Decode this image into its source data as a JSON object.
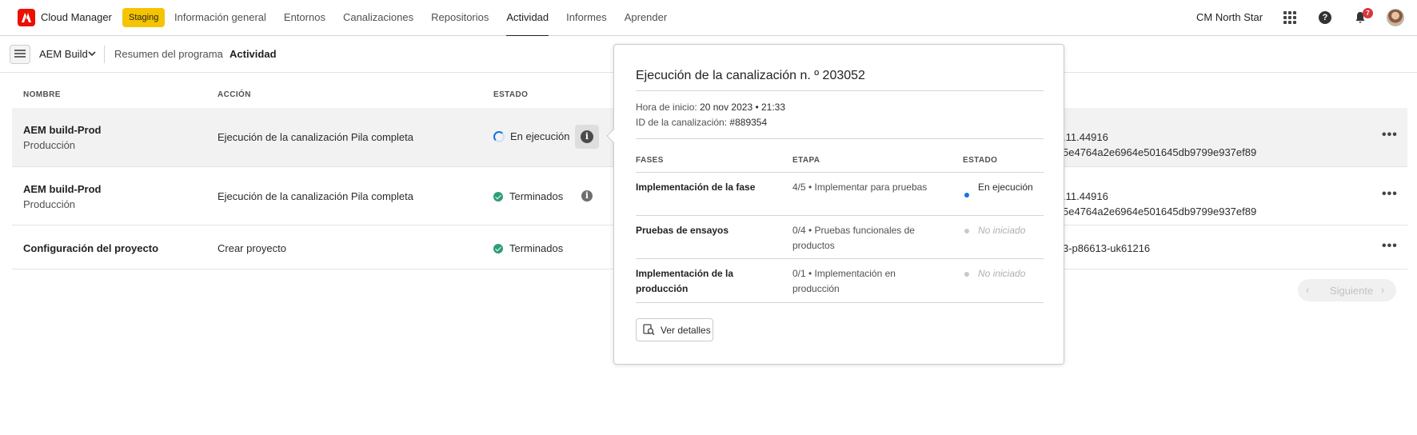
{
  "app": {
    "name": "Cloud Manager",
    "environment_badge": "Staging",
    "org_name": "CM North Star",
    "notification_count": "7"
  },
  "nav": {
    "items": [
      {
        "label": "Información general",
        "active": false
      },
      {
        "label": "Entornos",
        "active": false
      },
      {
        "label": "Canalizaciones",
        "active": false
      },
      {
        "label": "Repositorios",
        "active": false
      },
      {
        "label": "Actividad",
        "active": true
      },
      {
        "label": "Informes",
        "active": false
      },
      {
        "label": "Aprender",
        "active": false
      }
    ]
  },
  "subheader": {
    "program": "AEM Build",
    "breadcrumb_parent": "Resumen del programa",
    "breadcrumb_separator": "›",
    "breadcrumb_current": "Actividad"
  },
  "table": {
    "headers": {
      "name": "NOMBRE",
      "action": "ACCIÓN",
      "status": "ESTADO"
    },
    "rows": [
      {
        "name": "AEM build-Prod",
        "sub": "Producción",
        "action": "Ejecución de la canalización Pila completa",
        "status": "En ejecución",
        "details_1": ".11.44916",
        "details_2": "5e4764a2e6964e501645db9799e937ef89",
        "more": "•••"
      },
      {
        "name": "AEM build-Prod",
        "sub": "Producción",
        "action": "Ejecución de la canalización Pila completa",
        "status": "Terminados",
        "details_1": ".11.44916",
        "details_2": "5e4764a2e6964e501645db9799e937ef89",
        "more": "•••"
      },
      {
        "name": "Configuración del proyecto",
        "sub": "",
        "action": "Crear proyecto",
        "status": "Terminados",
        "details_1": "3-p86613-uk61216",
        "details_2": "",
        "more": "•••"
      }
    ]
  },
  "pagination": {
    "prev": "‹",
    "next_label": "Siguiente",
    "next": "›"
  },
  "popover": {
    "title": "Ejecución de la canalización n. º 203052",
    "start_label": "Hora de inicio:",
    "start_value": "20 nov 2023 • 21:33",
    "id_label": "ID de la canalización:",
    "id_value": "#889354",
    "headers": {
      "phase": "FASES",
      "step": "ETAPA",
      "status": "ESTADO"
    },
    "rows": [
      {
        "phase": "Implementación de la fase",
        "step": "4/5 • Implementar para pruebas",
        "status": "En ejecución",
        "status_color": "#1473e6"
      },
      {
        "phase": "Pruebas de ensayos",
        "step": "0/4 • Pruebas funcionales de productos",
        "status": "No iniciado",
        "status_color": "#c8c8c8"
      },
      {
        "phase": "Implementación de la producción",
        "step": "0/1 • Implementación en producción",
        "status": "No iniciado",
        "status_color": "#c8c8c8"
      }
    ],
    "view_details": "Ver detalles"
  },
  "colors": {
    "brand": "#eb1000",
    "staging": "#f5c400",
    "running": "#1473e6",
    "success": "#2d9d78"
  },
  "icons": {
    "logo": "adobe-logo-icon",
    "apps": "apps-grid-icon",
    "help": "help-icon",
    "bell": "bell-icon",
    "info": "info-icon",
    "spinner": "spinner-icon",
    "check": "check-circle-icon",
    "view": "view-details-icon"
  }
}
